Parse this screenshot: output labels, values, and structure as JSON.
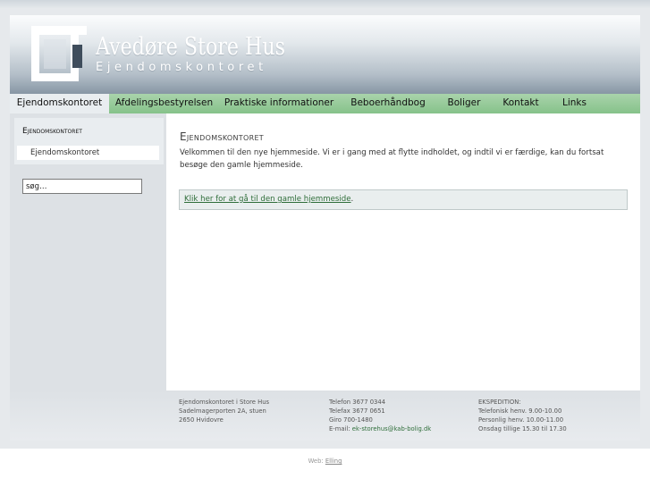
{
  "brand": {
    "title": "Avedøre Store Hus",
    "subtitle": "Ejendomskontoret"
  },
  "nav": {
    "items": [
      {
        "label": "Ejendomskontoret",
        "active": true
      },
      {
        "label": "Afdelingsbestyrelsen",
        "active": false
      },
      {
        "label": "Praktiske informationer",
        "active": false
      },
      {
        "label": "Beboerhåndbog",
        "active": false
      },
      {
        "label": "Boliger",
        "active": false
      },
      {
        "label": "Kontakt",
        "active": false
      },
      {
        "label": "Links",
        "active": false
      }
    ]
  },
  "sidebar": {
    "heading": "Ejendomskontoret",
    "link": "Ejendomskontoret",
    "search_value": "søg…"
  },
  "main": {
    "title": "Ejendomskontoret",
    "body": "Velkommen til den nye hjemmeside. Vi er i gang med at flytte indholdet, og indtil vi er færdige, kan du fortsat besøge den gamle hjemmeside.",
    "notice_link": "Klik her for at gå til den gamle hjemmeside",
    "notice_suffix": "."
  },
  "footer": {
    "address": [
      "Ejendomskontoret i Store Hus",
      "Sadelmagerporten 2A, stuen",
      "2650 Hvidovre"
    ],
    "phone": "Telefon 3677 0344",
    "fax": "Telefax 3677 0651",
    "giro": "Giro 700-1480",
    "email_label": "E-mail: ",
    "email": "ek-storehus@kab-bolig.dk",
    "hours_title": "EKSPEDITION:",
    "hours": [
      "Telefonisk henv. 9.00-10.00",
      "Personlig henv. 10.00-11.00",
      "Onsdag tillige 15.30 til 17.30"
    ]
  },
  "credit": {
    "prefix": "Web: ",
    "link": "Elling"
  },
  "colors": {
    "nav": "#86c28a",
    "link": "#2f6e3a",
    "header_dark": "#8796a4"
  }
}
